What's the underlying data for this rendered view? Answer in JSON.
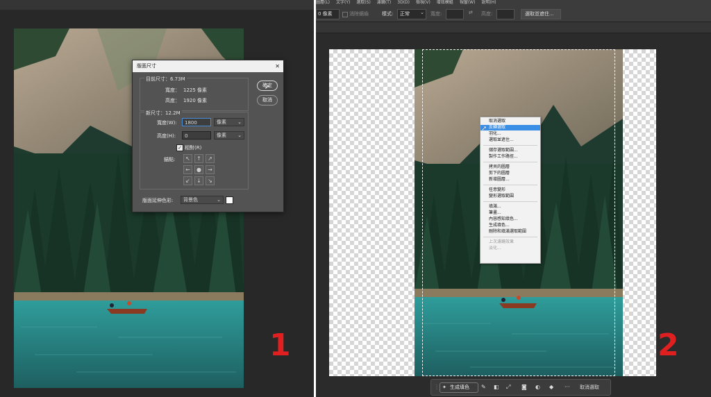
{
  "left_panel": {
    "dialog": {
      "title": "版面尺寸",
      "close_glyph": "✕",
      "current_size_label": "目前尺寸：6.73M",
      "current_width_label": "寬度：",
      "current_width_value": "1225 像素",
      "current_height_label": "高度：",
      "current_height_value": "1920 像素",
      "new_size_label": "新尺寸：12.2M",
      "width_label": "寬度(W):",
      "width_value": "1800",
      "width_unit": "像素",
      "height_label": "高度(H):",
      "height_value": "0",
      "height_unit": "像素",
      "relative_label": "相對(R)",
      "relative_checked": true,
      "anchor_label": "錨點:",
      "extension_label": "版面延伸色彩:",
      "extension_value": "背景色",
      "ok_button": "確定",
      "cancel_button": "取消"
    },
    "step_number": "1"
  },
  "right_panel": {
    "menubar": [
      "圖層(L)",
      "文字(Y)",
      "選取(S)",
      "濾鏡(T)",
      "3D(D)",
      "檢視(V)",
      "增效模組",
      "視窗(W)",
      "說明(H)"
    ],
    "options_bar": {
      "feather_value": "0 像素",
      "anti_alias_label": "消除鋸齒",
      "style_label": "樣式:",
      "style_value": "正常",
      "width_label": "寬度:",
      "height_label": "高度:",
      "select_mask_button": "選取並遮住..."
    },
    "context_menu": {
      "items": [
        "取消選取",
        "反轉選取",
        "羽化...",
        "選取並遮住...",
        "儲存選取範圍...",
        "製作工作路徑...",
        "拷貝的圖層",
        "剪下的圖層",
        "新增圖層...",
        "任意變形",
        "變形選取範圍",
        "填滿...",
        "筆畫...",
        "內容感知填色...",
        "生成填色...",
        "刪除和填滿選取範圍",
        "上次濾鏡效果",
        "淡化..."
      ],
      "highlighted_index": 1,
      "disabled_indices": [
        16,
        17
      ]
    },
    "bottom_toolbar": {
      "generate_fill": "生成填色",
      "more": "···",
      "deselect": "取消選取"
    },
    "step_number": "2"
  },
  "colors": {
    "step_number_color": "#e02020",
    "menu_highlight": "#3a8ee6",
    "dialog_bg": "#535353",
    "app_bg": "#2b2b2b"
  }
}
